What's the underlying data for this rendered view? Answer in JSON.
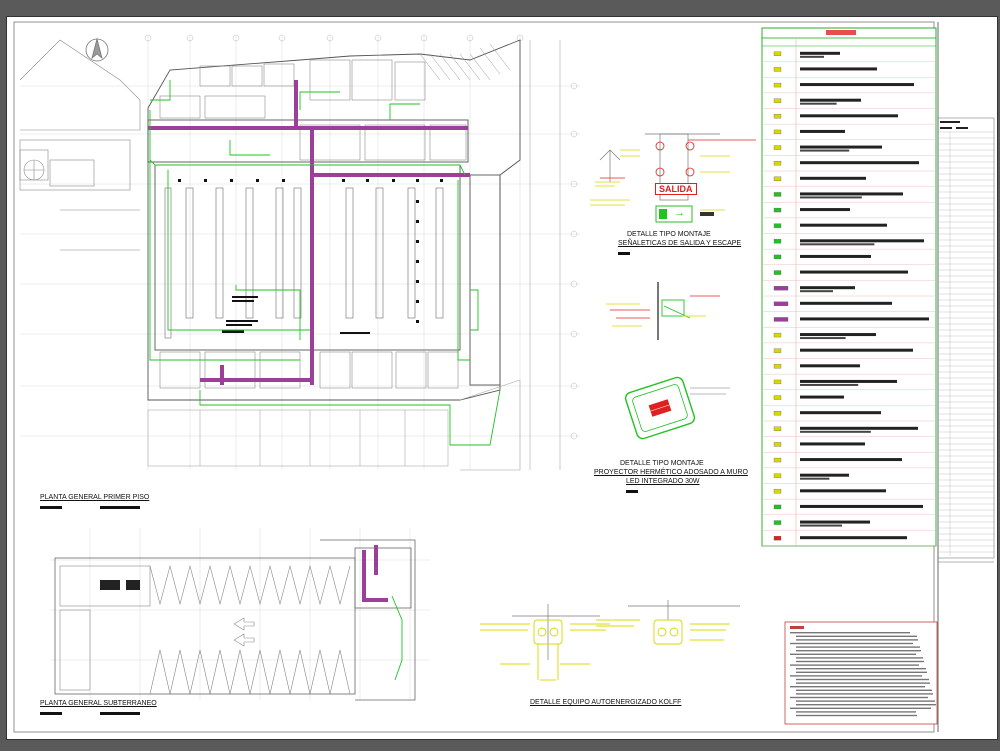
{
  "drawing": {
    "plan_primer_piso": "PLANTA GENERAL PRIMER PISO",
    "plan_subterraneo": "PLANTA GENERAL SUBTERRANEO",
    "detalle_senaleticas_l1": "DETALLE TIPO MONTAJE",
    "detalle_senaleticas_l2": "SEÑALETICAS DE SALIDA Y ESCAPE",
    "detalle_proyector_l1": "DETALLE TIPO MONTAJE",
    "detalle_proyector_l2": "PROYECTOR HERMÉTICO ADOSADO A MURO",
    "detalle_proyector_l3": "LED INTEGRADO 30W",
    "detalle_kolff": "DETALLE EQUIPO AUTOENERGIZADO KOLFF",
    "sign_salida": "SALIDA",
    "exit_arrow": "→"
  },
  "legend": {
    "rows": 32
  },
  "colors": {
    "green": "#22c222",
    "purple": "#9b3f9b",
    "yellow": "#d8d800",
    "red": "#e02020",
    "grey": "#8f8f8f"
  }
}
